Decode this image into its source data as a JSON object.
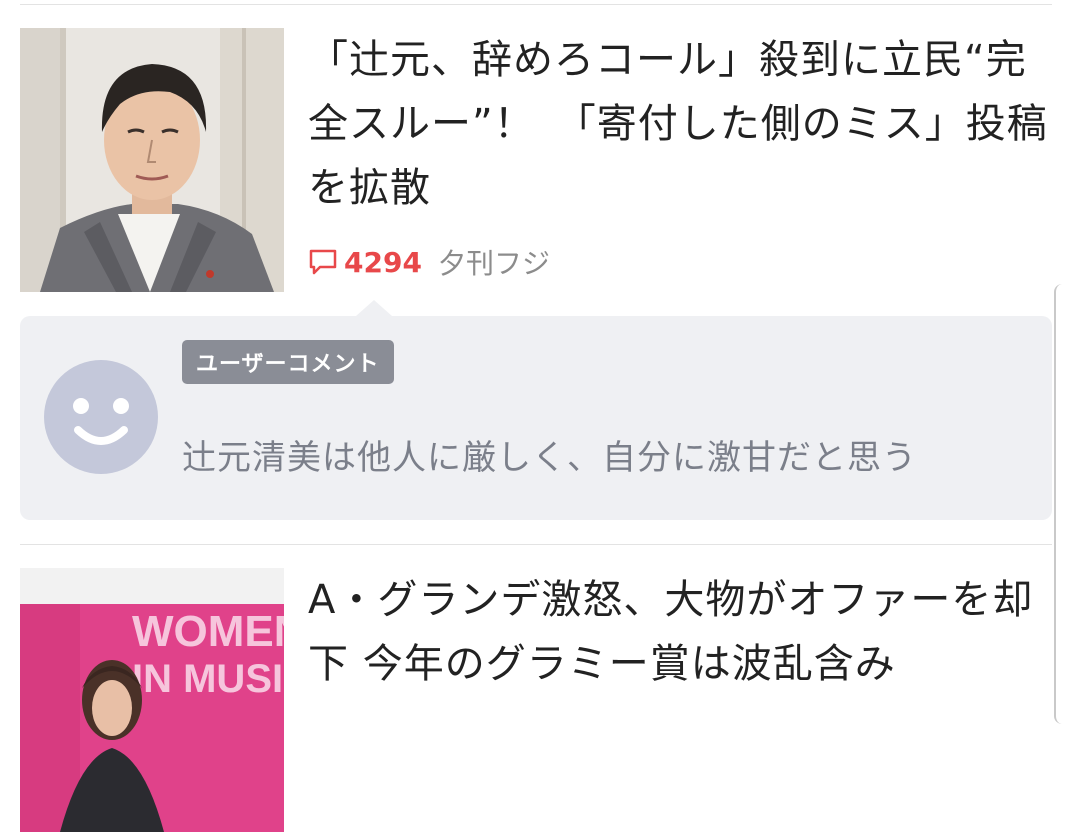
{
  "articles": [
    {
      "headline": "「辻元、辞めろコール」殺到に立民“完全スルー”！　「寄付した側のミス」投稿を拡散",
      "comment_count": "4294",
      "source": "夕刊フジ",
      "thumbnail": "politician-portrait-photo"
    },
    {
      "headline": "A・グランデ激怒、大物がオファーを却下 今年のグラミー賞は波乱含み",
      "thumbnail": "women-in-music-event-photo",
      "thumbnail_backdrop_text": "WOMEN IN MUSIC"
    }
  ],
  "user_comment": {
    "badge_label": "ユーザーコメント",
    "text": "辻元清美は他人に厳しく、自分に激甘だと思う",
    "avatar": "smiley-avatar-icon"
  },
  "colors": {
    "accent_red": "#e8484a",
    "comment_bg": "#eff0f3",
    "badge_bg": "#8a8d96",
    "avatar_bg": "#c4c8da"
  }
}
